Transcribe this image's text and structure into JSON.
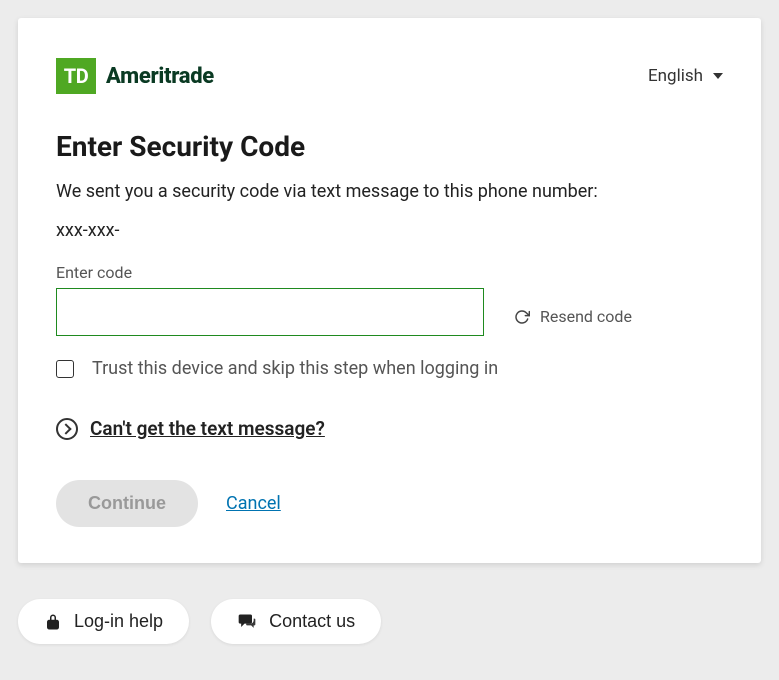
{
  "header": {
    "brand_box": "TD",
    "brand_text": "Ameritrade",
    "language": "English"
  },
  "main": {
    "title": "Enter Security Code",
    "subtitle": "We sent you a security code via text message to this phone number:",
    "masked_phone": "xxx-xxx-",
    "code_label": "Enter code",
    "resend_label": "Resend code",
    "trust_label": "Trust this device and skip this step when logging in",
    "help_link": "Can't get the text message?",
    "continue_label": "Continue",
    "cancel_label": "Cancel"
  },
  "footer": {
    "login_help": "Log-in help",
    "contact_us": "Contact us"
  }
}
